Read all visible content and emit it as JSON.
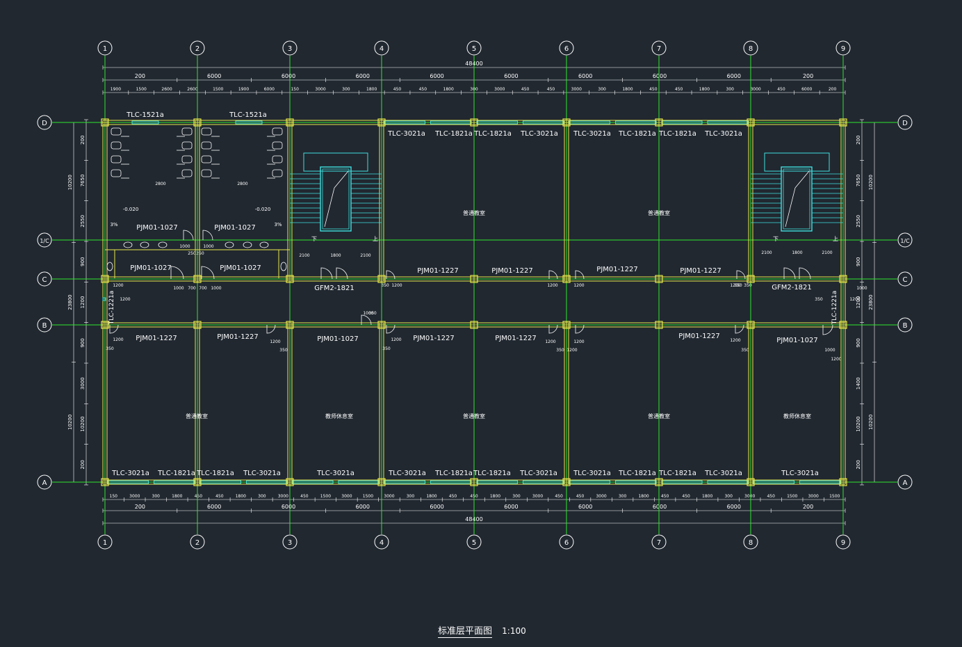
{
  "colors": {
    "background": "#212830",
    "axis": "#2ee62e",
    "wall": "#e8e84a",
    "window": "#40e0e0",
    "dim": "#ffffff",
    "bubble": "#ffffff",
    "text": "#ffffff",
    "fixture": "#ffffff"
  },
  "grid": {
    "columns": [
      "1",
      "2",
      "3",
      "4",
      "5",
      "6",
      "7",
      "8",
      "9"
    ],
    "rows": [
      "D",
      "1/C",
      "C",
      "B",
      "A"
    ]
  },
  "dimensions": {
    "top_total": "48400",
    "top_row1": [
      "200",
      "6000",
      "6000",
      "6000",
      "6000",
      "6000",
      "6000",
      "6000",
      "6000",
      "200"
    ],
    "top_row2": [
      "1900",
      "1500",
      "2600",
      "2600",
      "1500",
      "1900",
      "6000",
      "150",
      "3000",
      "300",
      "1800",
      "450",
      "450",
      "1800",
      "300",
      "3000",
      "450",
      "450",
      "3000",
      "300",
      "1800",
      "450",
      "450",
      "1800",
      "300",
      "3000",
      "450",
      "6000",
      "200"
    ],
    "bottom_total": "48400",
    "bottom_row1": [
      "200",
      "6000",
      "6000",
      "6000",
      "6000",
      "6000",
      "6000",
      "6000",
      "6000",
      "200"
    ],
    "bottom_row2": [
      "150",
      "3000",
      "300",
      "1800",
      "450",
      "450",
      "1800",
      "300",
      "3000",
      "450",
      "1500",
      "3000",
      "1500",
      "3000",
      "300",
      "1800",
      "450",
      "450",
      "1800",
      "300",
      "3000",
      "450",
      "450",
      "3000",
      "300",
      "1800",
      "450",
      "450",
      "1800",
      "300",
      "3000",
      "450",
      "1500",
      "3000",
      "1500"
    ],
    "left_outer": [
      "10200",
      "23800",
      "10200"
    ],
    "left_inner": [
      "200",
      "7650",
      "2550",
      "900",
      "1200",
      "900",
      "3000",
      "10200",
      "200"
    ],
    "right_inner": [
      "200",
      "7650",
      "2550",
      "900",
      "1200",
      "900",
      "1400",
      "10200",
      "200"
    ],
    "right_outer": [
      "10200",
      "23800",
      "10200"
    ],
    "misc": [
      "2800",
      "2800",
      "2100",
      "1800",
      "2100",
      "2100",
      "1800",
      "2100",
      "1000",
      "1000",
      "250",
      "250",
      "1000",
      "700",
      "700",
      "1000",
      "1200",
      "1200",
      "1200",
      "1200",
      "1200",
      "350",
      "350",
      "1200",
      "1200",
      "350",
      "350",
      "1000",
      "350",
      "1200",
      "1200",
      "1000",
      "1200",
      "350",
      "1200",
      "350",
      "1200",
      "350",
      "1200",
      "1200",
      "1000",
      "350",
      "1200",
      "350"
    ]
  },
  "labels": {
    "window_top_wc": [
      "TLC-1521a",
      "TLC-1521a"
    ],
    "window_top": [
      "TLC-3021a",
      "TLC-1821a",
      "TLC-1821a",
      "TLC-3021a",
      "TLC-3021a",
      "TLC-1821a",
      "TLC-1821a",
      "TLC-3021a"
    ],
    "window_bottom": [
      "TLC-3021a",
      "TLC-1821a",
      "TLC-1821a",
      "TLC-3021a",
      "TLC-3021a",
      "TLC-3021a",
      "TLC-1821a",
      "TLC-1821a",
      "TLC-3021a",
      "TLC-3021a",
      "TLC-1821a",
      "TLC-1821a",
      "TLC-3021a",
      "TLC-3021a"
    ],
    "window_side": [
      "TLC-1221a",
      "TLC-1221a"
    ],
    "doors_wc": [
      "PJM01-1027",
      "PJM01-1027",
      "PJM01-1027",
      "PJM01-1027"
    ],
    "doors_c_line": [
      "GFM2-1821",
      "PJM01-1227",
      "PJM01-1227",
      "PJM01-1227",
      "PJM01-1227",
      "GFM2-1821"
    ],
    "doors_b_line": [
      "PJM01-1227",
      "PJM01-1227",
      "PJM01-1027",
      "PJM01-1227",
      "PJM01-1227",
      "PJM01-1227",
      "PJM01-1027"
    ],
    "levels": [
      "-0.020",
      "-0.020",
      "3%",
      "3%"
    ],
    "stair": [
      "下",
      "上",
      "下",
      "上"
    ],
    "rooms": [
      "普通教室",
      "普通教室",
      "普通教室",
      "教师休息室",
      "普通教室",
      "普通教室",
      "教师休息室"
    ]
  },
  "caption": {
    "title": "标准层平面图",
    "scale": "1:100"
  }
}
